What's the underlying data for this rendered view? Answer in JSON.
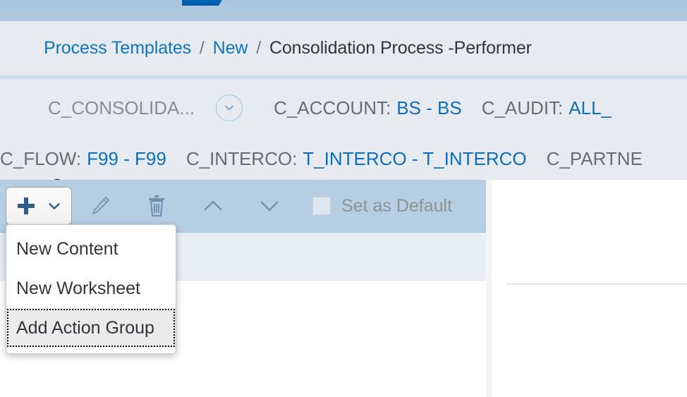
{
  "shell": {
    "logo_name": "sap-logo"
  },
  "breadcrumb": {
    "items": [
      {
        "label": "Process Templates",
        "type": "link"
      },
      {
        "label": "New",
        "type": "link"
      },
      {
        "label": "Consolidation Process -Performer",
        "type": "current"
      }
    ],
    "separator": "/"
  },
  "filter_bar": {
    "locked_dimension": {
      "icon": "lock-icon",
      "label": "C_CONSOLIDA..."
    },
    "expand_icon": "chevron-down-circle-icon",
    "row1": [
      {
        "key": "C_ACCOUNT:",
        "value": "BS - BS"
      },
      {
        "key": "C_AUDIT:",
        "value": "ALL_"
      }
    ],
    "row2": [
      {
        "key": "C_FLOW:",
        "value": "F99 - F99"
      },
      {
        "key": "C_INTERCO:",
        "value": "T_INTERCO - T_INTERCO"
      },
      {
        "key": "C_PARTNE",
        "value": ""
      }
    ]
  },
  "toolbar": {
    "add_button": {
      "icon": "plus-icon",
      "arrow_icon": "chevron-down-icon"
    },
    "edit_button": {
      "icon": "pencil-icon"
    },
    "delete_button": {
      "icon": "trash-icon"
    },
    "move_up_button": {
      "icon": "chevron-up-icon"
    },
    "move_down_button": {
      "icon": "chevron-down-icon"
    },
    "set_default": {
      "label": "Set as Default",
      "checked": false
    }
  },
  "menu": {
    "items": [
      {
        "label": "New Content",
        "focused": false
      },
      {
        "label": "New Worksheet",
        "focused": false
      },
      {
        "label": "Add Action Group",
        "focused": true
      }
    ]
  },
  "colors": {
    "shell_blue": "#a7c5dd",
    "band_gray": "#e7ebef",
    "toolbar_blue": "#b6cee2",
    "link_blue": "#0a6fc4",
    "breadcrumb_link": "#0a77c6",
    "text_dark": "#32363a",
    "text_muted": "#6a6d70",
    "grid_header": "#e8eef4"
  }
}
